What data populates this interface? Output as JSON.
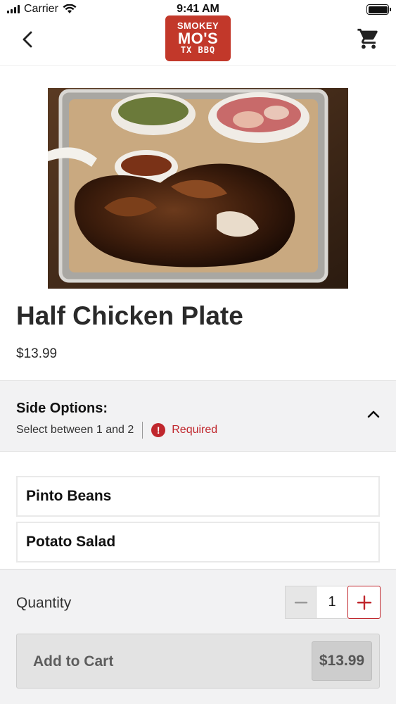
{
  "status_bar": {
    "carrier": "Carrier",
    "time": "9:41 AM"
  },
  "nav": {
    "back_icon": "chevron-left-icon",
    "cart_icon": "shopping-cart-icon",
    "logo": {
      "line1": "SMOKEY",
      "line2": "MO'S",
      "line3": "TX BBQ"
    }
  },
  "product": {
    "title": "Half Chicken Plate",
    "price": "$13.99",
    "image_alt": "Half Chicken Plate"
  },
  "side_options": {
    "title": "Side Options:",
    "subtitle": "Select between 1 and 2",
    "required_icon": "!",
    "required_label": "Required",
    "items": [
      "Pinto Beans",
      "Potato Salad"
    ]
  },
  "quantity": {
    "label": "Quantity",
    "value": "1"
  },
  "add_to_cart": {
    "label": "Add to Cart",
    "price": "$13.99"
  },
  "colors": {
    "brand_red": "#c2382a",
    "required_red": "#c0272d",
    "panel_gray": "#f2f2f3"
  }
}
